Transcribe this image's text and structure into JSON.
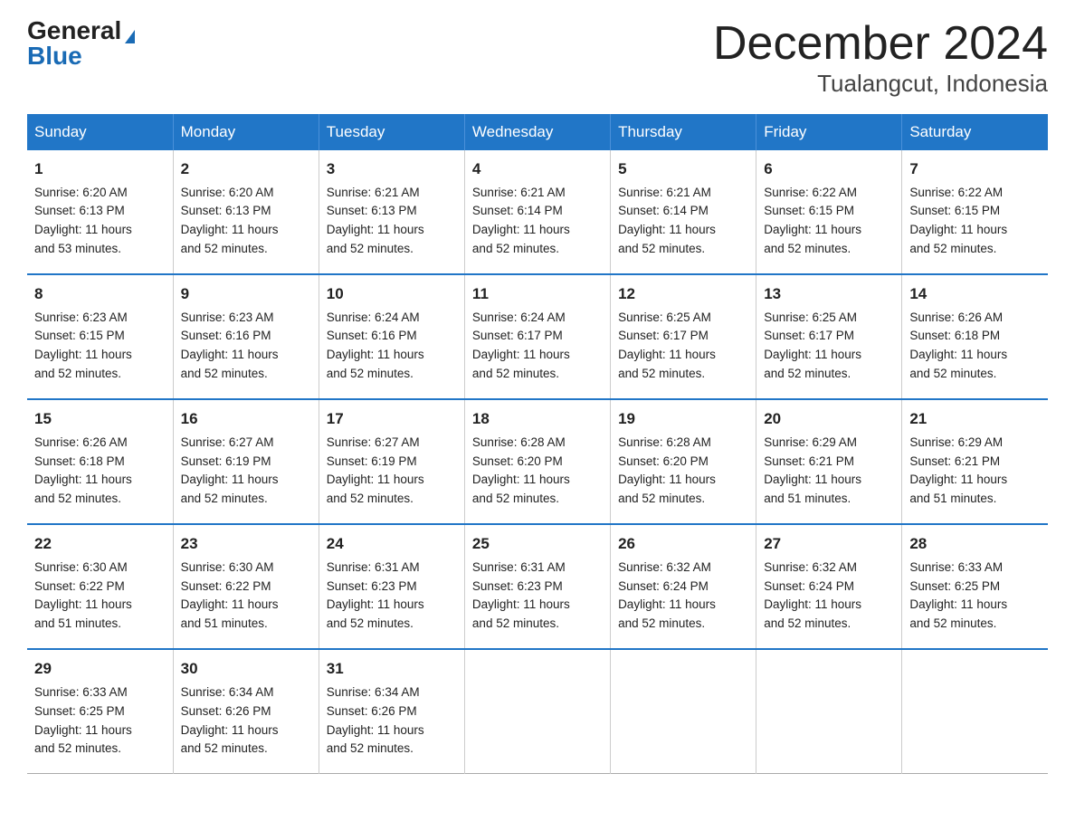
{
  "logo": {
    "general": "General",
    "blue": "Blue"
  },
  "title": "December 2024",
  "location": "Tualangcut, Indonesia",
  "days_header": [
    "Sunday",
    "Monday",
    "Tuesday",
    "Wednesday",
    "Thursday",
    "Friday",
    "Saturday"
  ],
  "weeks": [
    [
      {
        "day": "1",
        "sunrise": "6:20 AM",
        "sunset": "6:13 PM",
        "daylight": "11 hours and 53 minutes."
      },
      {
        "day": "2",
        "sunrise": "6:20 AM",
        "sunset": "6:13 PM",
        "daylight": "11 hours and 52 minutes."
      },
      {
        "day": "3",
        "sunrise": "6:21 AM",
        "sunset": "6:13 PM",
        "daylight": "11 hours and 52 minutes."
      },
      {
        "day": "4",
        "sunrise": "6:21 AM",
        "sunset": "6:14 PM",
        "daylight": "11 hours and 52 minutes."
      },
      {
        "day": "5",
        "sunrise": "6:21 AM",
        "sunset": "6:14 PM",
        "daylight": "11 hours and 52 minutes."
      },
      {
        "day": "6",
        "sunrise": "6:22 AM",
        "sunset": "6:15 PM",
        "daylight": "11 hours and 52 minutes."
      },
      {
        "day": "7",
        "sunrise": "6:22 AM",
        "sunset": "6:15 PM",
        "daylight": "11 hours and 52 minutes."
      }
    ],
    [
      {
        "day": "8",
        "sunrise": "6:23 AM",
        "sunset": "6:15 PM",
        "daylight": "11 hours and 52 minutes."
      },
      {
        "day": "9",
        "sunrise": "6:23 AM",
        "sunset": "6:16 PM",
        "daylight": "11 hours and 52 minutes."
      },
      {
        "day": "10",
        "sunrise": "6:24 AM",
        "sunset": "6:16 PM",
        "daylight": "11 hours and 52 minutes."
      },
      {
        "day": "11",
        "sunrise": "6:24 AM",
        "sunset": "6:17 PM",
        "daylight": "11 hours and 52 minutes."
      },
      {
        "day": "12",
        "sunrise": "6:25 AM",
        "sunset": "6:17 PM",
        "daylight": "11 hours and 52 minutes."
      },
      {
        "day": "13",
        "sunrise": "6:25 AM",
        "sunset": "6:17 PM",
        "daylight": "11 hours and 52 minutes."
      },
      {
        "day": "14",
        "sunrise": "6:26 AM",
        "sunset": "6:18 PM",
        "daylight": "11 hours and 52 minutes."
      }
    ],
    [
      {
        "day": "15",
        "sunrise": "6:26 AM",
        "sunset": "6:18 PM",
        "daylight": "11 hours and 52 minutes."
      },
      {
        "day": "16",
        "sunrise": "6:27 AM",
        "sunset": "6:19 PM",
        "daylight": "11 hours and 52 minutes."
      },
      {
        "day": "17",
        "sunrise": "6:27 AM",
        "sunset": "6:19 PM",
        "daylight": "11 hours and 52 minutes."
      },
      {
        "day": "18",
        "sunrise": "6:28 AM",
        "sunset": "6:20 PM",
        "daylight": "11 hours and 52 minutes."
      },
      {
        "day": "19",
        "sunrise": "6:28 AM",
        "sunset": "6:20 PM",
        "daylight": "11 hours and 52 minutes."
      },
      {
        "day": "20",
        "sunrise": "6:29 AM",
        "sunset": "6:21 PM",
        "daylight": "11 hours and 51 minutes."
      },
      {
        "day": "21",
        "sunrise": "6:29 AM",
        "sunset": "6:21 PM",
        "daylight": "11 hours and 51 minutes."
      }
    ],
    [
      {
        "day": "22",
        "sunrise": "6:30 AM",
        "sunset": "6:22 PM",
        "daylight": "11 hours and 51 minutes."
      },
      {
        "day": "23",
        "sunrise": "6:30 AM",
        "sunset": "6:22 PM",
        "daylight": "11 hours and 51 minutes."
      },
      {
        "day": "24",
        "sunrise": "6:31 AM",
        "sunset": "6:23 PM",
        "daylight": "11 hours and 52 minutes."
      },
      {
        "day": "25",
        "sunrise": "6:31 AM",
        "sunset": "6:23 PM",
        "daylight": "11 hours and 52 minutes."
      },
      {
        "day": "26",
        "sunrise": "6:32 AM",
        "sunset": "6:24 PM",
        "daylight": "11 hours and 52 minutes."
      },
      {
        "day": "27",
        "sunrise": "6:32 AM",
        "sunset": "6:24 PM",
        "daylight": "11 hours and 52 minutes."
      },
      {
        "day": "28",
        "sunrise": "6:33 AM",
        "sunset": "6:25 PM",
        "daylight": "11 hours and 52 minutes."
      }
    ],
    [
      {
        "day": "29",
        "sunrise": "6:33 AM",
        "sunset": "6:25 PM",
        "daylight": "11 hours and 52 minutes."
      },
      {
        "day": "30",
        "sunrise": "6:34 AM",
        "sunset": "6:26 PM",
        "daylight": "11 hours and 52 minutes."
      },
      {
        "day": "31",
        "sunrise": "6:34 AM",
        "sunset": "6:26 PM",
        "daylight": "11 hours and 52 minutes."
      },
      null,
      null,
      null,
      null
    ]
  ],
  "labels": {
    "sunrise": "Sunrise:",
    "sunset": "Sunset:",
    "daylight": "Daylight:"
  }
}
